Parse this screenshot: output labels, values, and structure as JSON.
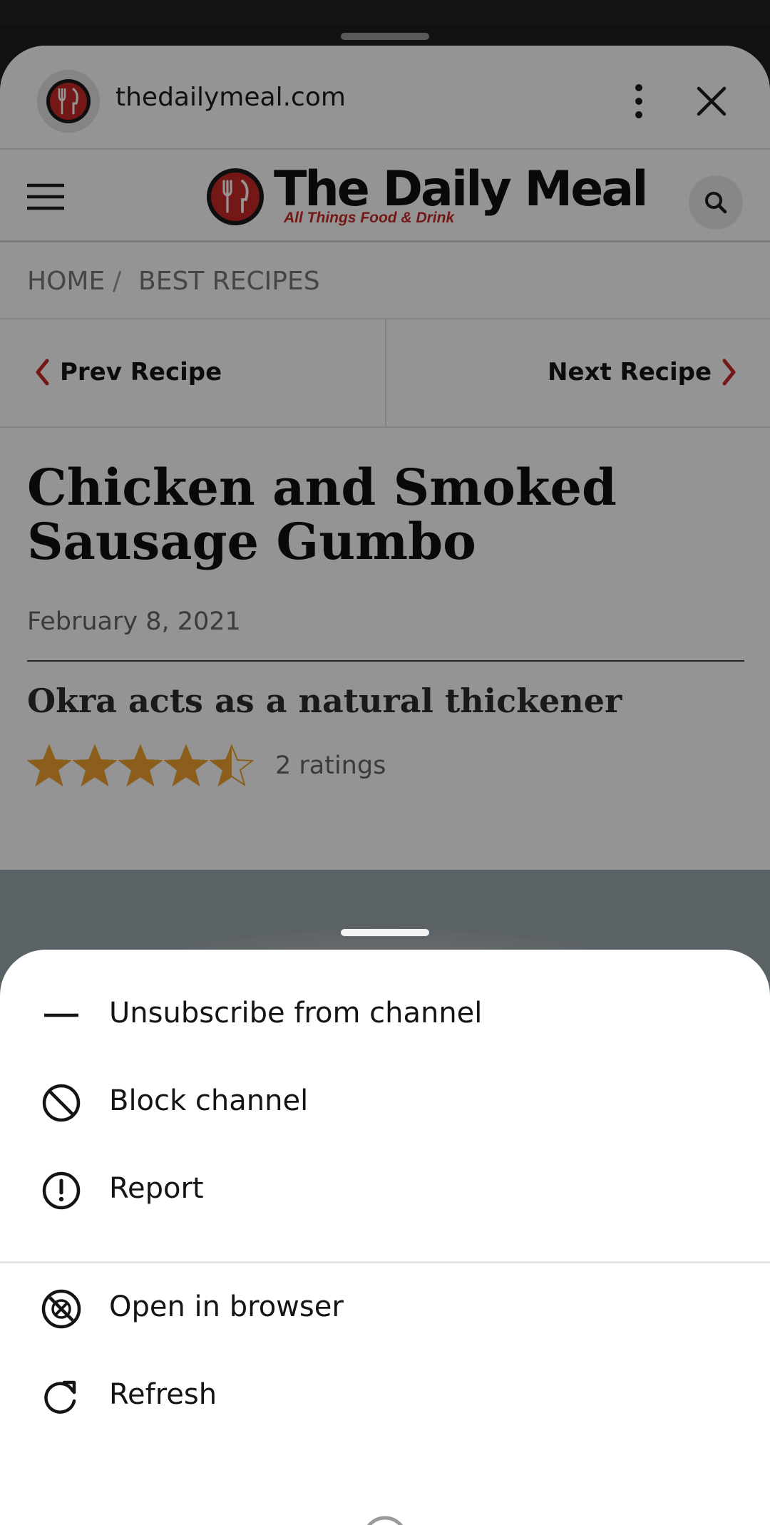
{
  "browser": {
    "url": "thedailymeal.com"
  },
  "site": {
    "logo_title": "The Daily Meal",
    "logo_tagline": "All Things Food & Drink"
  },
  "breadcrumb": {
    "home": "HOME",
    "separator": "/",
    "section": "BEST RECIPES"
  },
  "recipe_nav": {
    "prev": "Prev Recipe",
    "next": "Next Recipe"
  },
  "article": {
    "title_line1": "Chicken and Smoked",
    "title_line2": "Sausage Gumbo",
    "date": "February 8, 2021",
    "subtitle": "Okra acts as a natural thickener",
    "rating_value": 4.5,
    "rating_max": 5,
    "ratings_count": "2 ratings"
  },
  "menu": {
    "items": [
      {
        "label": "Unsubscribe from channel",
        "icon": "minus-icon"
      },
      {
        "label": "Block channel",
        "icon": "block-icon"
      },
      {
        "label": "Report",
        "icon": "exclamation-circle-icon"
      },
      {
        "label": "Open in browser",
        "icon": "browser-globe-icon"
      },
      {
        "label": "Refresh",
        "icon": "refresh-icon"
      }
    ]
  },
  "colors": {
    "brand_red": "#c62828",
    "star_gold": "#f0a330",
    "scrim": "rgba(0,0,0,0.42)"
  }
}
